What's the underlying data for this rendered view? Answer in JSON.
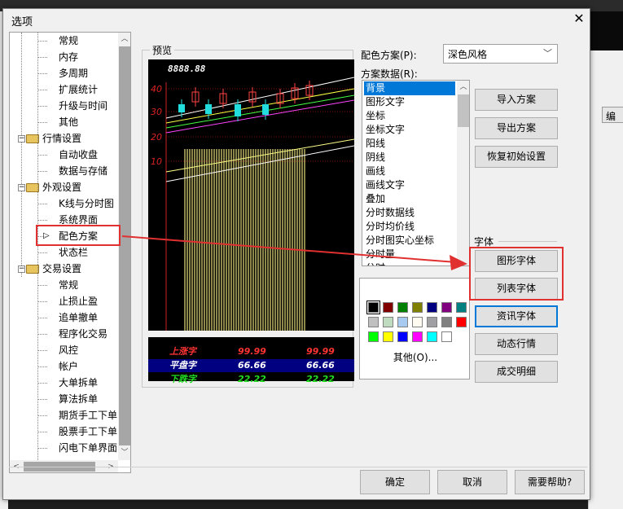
{
  "window": {
    "title": "选项",
    "close_glyph": "✕"
  },
  "tree": {
    "items": [
      {
        "label": "常规",
        "level": 2
      },
      {
        "label": "内存",
        "level": 2
      },
      {
        "label": "多周期",
        "level": 2
      },
      {
        "label": "扩展统计",
        "level": 2
      },
      {
        "label": "升级与时间",
        "level": 2
      },
      {
        "label": "其他",
        "level": 2
      },
      {
        "label": "行情设置",
        "level": 1
      },
      {
        "label": "自动收盘",
        "level": 2
      },
      {
        "label": "数据与存储",
        "level": 2
      },
      {
        "label": "外观设置",
        "level": 1
      },
      {
        "label": "K线与分时图",
        "level": 2
      },
      {
        "label": "系统界面",
        "level": 2
      },
      {
        "label": "配色方案",
        "level": 2,
        "selected": true
      },
      {
        "label": "状态栏",
        "level": 2
      },
      {
        "label": "交易设置",
        "level": 1
      },
      {
        "label": "常规",
        "level": 2
      },
      {
        "label": "止损止盈",
        "level": 2
      },
      {
        "label": "追单撤单",
        "level": 2
      },
      {
        "label": "程序化交易",
        "level": 2
      },
      {
        "label": "风控",
        "level": 2
      },
      {
        "label": "帐户",
        "level": 2
      },
      {
        "label": "大单拆单",
        "level": 2
      },
      {
        "label": "算法拆单",
        "level": 2
      },
      {
        "label": "期货手工下单",
        "level": 2
      },
      {
        "label": "股票手工下单",
        "level": 2
      },
      {
        "label": "闪电下单界面",
        "level": 2
      }
    ]
  },
  "preview": {
    "label": "预览",
    "price_text": "8888.88",
    "axis_ticks": [
      "40",
      "30",
      "20",
      "10"
    ],
    "table": [
      {
        "label": "上涨字",
        "v1": "99.99",
        "v2": "99.99",
        "color": "#ff3333"
      },
      {
        "label": "平盘字",
        "v1": "66.66",
        "v2": "66.66",
        "color": "#ffffff"
      },
      {
        "label": "下跌字",
        "v1": "22.22",
        "v2": "22.22",
        "color": "#22dd22"
      }
    ]
  },
  "scheme": {
    "label": "配色方案(P):",
    "value": "深色风格",
    "data_label": "方案数据(R):",
    "items": [
      "背景",
      "图形文字",
      "坐标",
      "坐标文字",
      "阳线",
      "阴线",
      "画线",
      "画线文字",
      "叠加",
      "分时数据线",
      "分时均价线",
      "分时图实心坐标",
      "分时量",
      "分时"
    ],
    "selected_index": 0
  },
  "palette": {
    "colors": [
      "#000000",
      "#800000",
      "#008000",
      "#808000",
      "#000080",
      "#800080",
      "#008080",
      "#c0c0c0",
      "#c0dcc0",
      "#a6caf0",
      "#fffbf0",
      "#a0a0a4",
      "#808080",
      "#ff0000",
      "#00ff00",
      "#ffff00",
      "#0000ff",
      "#ff00ff",
      "#00ffff",
      "#ffffff"
    ],
    "selected_index": 0,
    "others_label": "其他(O)..."
  },
  "buttons": {
    "import": "导入方案",
    "export": "导出方案",
    "restore": "恢复初始设置",
    "font_group": "字体",
    "graph_font": "图形字体",
    "list_font": "列表字体",
    "news_font": "资讯字体",
    "dynamic": "动态行情",
    "deals": "成交明细",
    "ok": "确定",
    "cancel": "取消",
    "help": "需要帮助?"
  },
  "background": {
    "edit_label": "编"
  },
  "colors": {
    "selection": "#0078d7",
    "annotation": "#e03030",
    "chart_bg": "#000000"
  }
}
